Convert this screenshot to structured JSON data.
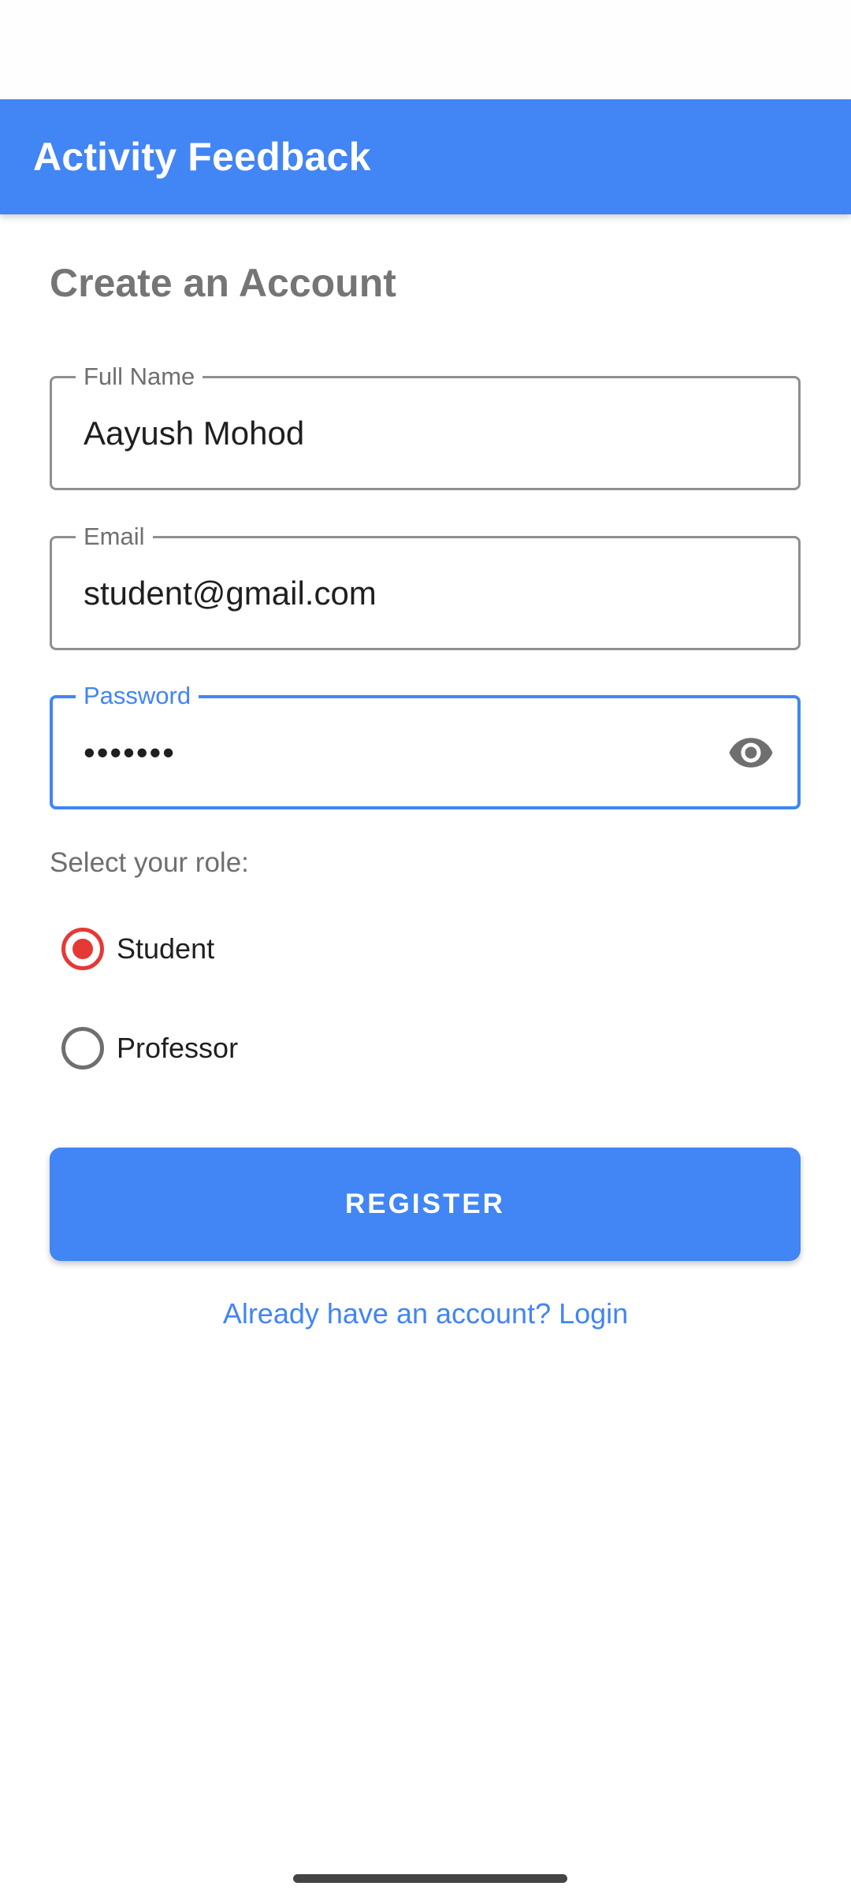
{
  "app_bar": {
    "title": "Activity Feedback"
  },
  "page": {
    "heading": "Create an Account"
  },
  "form": {
    "full_name": {
      "label": "Full Name",
      "value": "Aayush Mohod"
    },
    "email": {
      "label": "Email",
      "value": "student@gmail.com"
    },
    "password": {
      "label": "Password",
      "masked_value": "•••••••",
      "visibility_icon": "eye-icon",
      "focused": true
    },
    "role": {
      "label": "Select your role:",
      "options": [
        {
          "label": "Student",
          "selected": true
        },
        {
          "label": "Professor",
          "selected": false
        }
      ]
    },
    "register_button": "REGISTER",
    "login_link": "Already have an account? Login"
  },
  "colors": {
    "primary": "#4285f4",
    "radio_selected": "#e53935",
    "heading_gray": "#757575"
  }
}
